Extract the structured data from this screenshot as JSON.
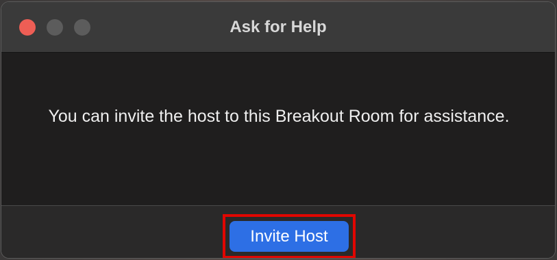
{
  "window": {
    "title": "Ask for Help"
  },
  "dialog": {
    "message": "You can invite the host to this Breakout Room for assistance.",
    "primary_button_label": "Invite Host"
  },
  "colors": {
    "close_button": "#ee5e55",
    "inactive_traffic_light": "#5c5c5c",
    "primary_button": "#2d6fe5",
    "highlight_box": "#e10600"
  }
}
